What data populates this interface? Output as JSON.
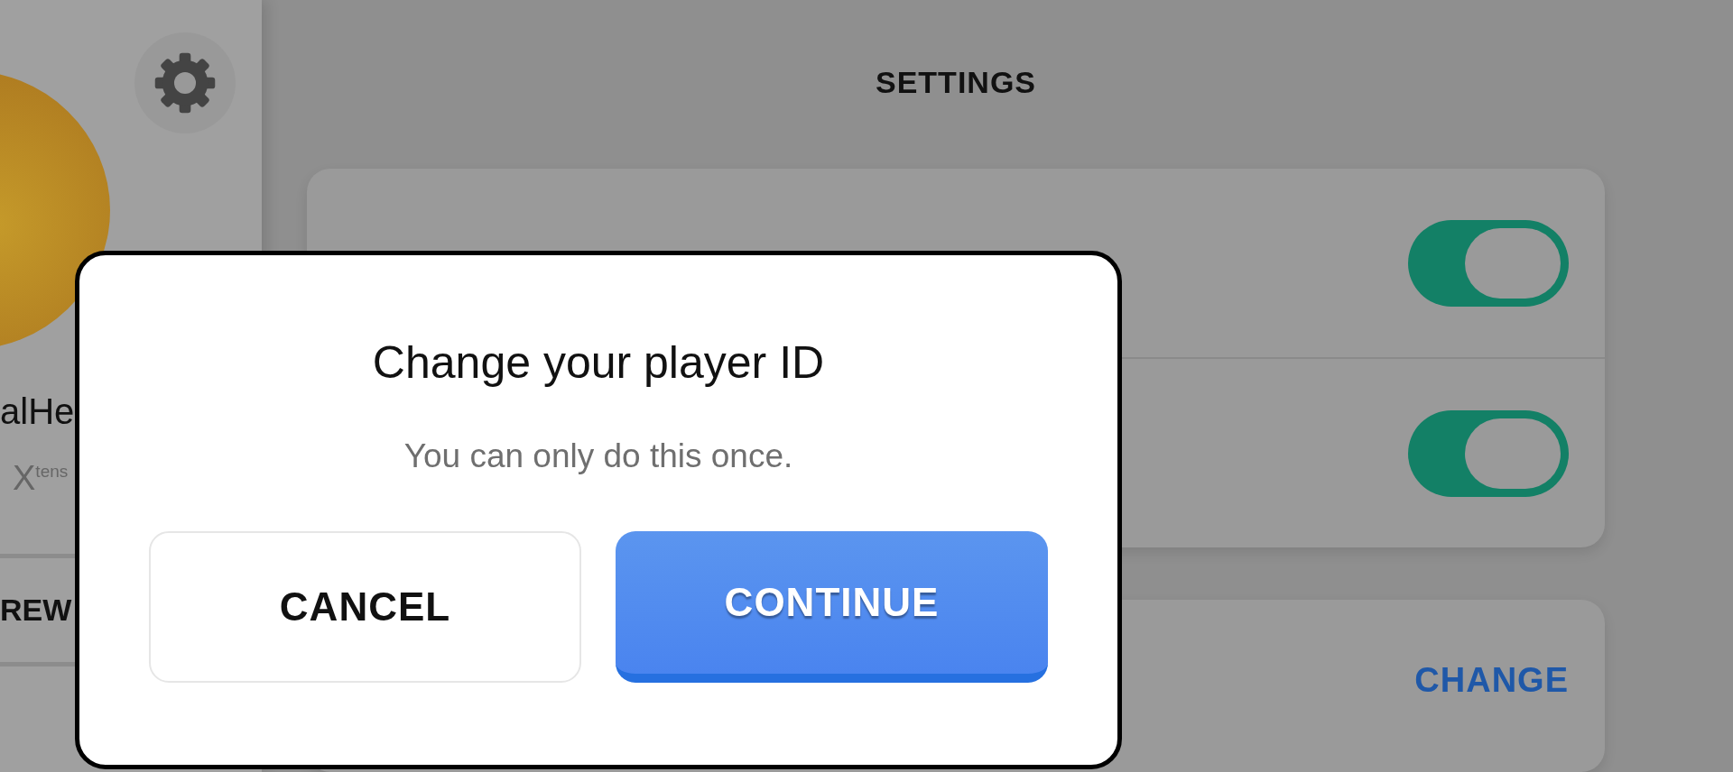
{
  "sidebar": {
    "player_name": "alHe",
    "club": "X$^{tens}$",
    "section": "REW"
  },
  "settings": {
    "title": "SETTINGS",
    "toggles": [
      {
        "on": true
      },
      {
        "on": true
      }
    ],
    "player_id": {
      "action": "CHANGE"
    }
  },
  "dialog": {
    "title": "Change your player ID",
    "message": "You can only do this once.",
    "buttons": [
      {
        "label": "CANCEL",
        "kind": "secondary"
      },
      {
        "label": "CONTINUE",
        "kind": "primary"
      }
    ]
  }
}
